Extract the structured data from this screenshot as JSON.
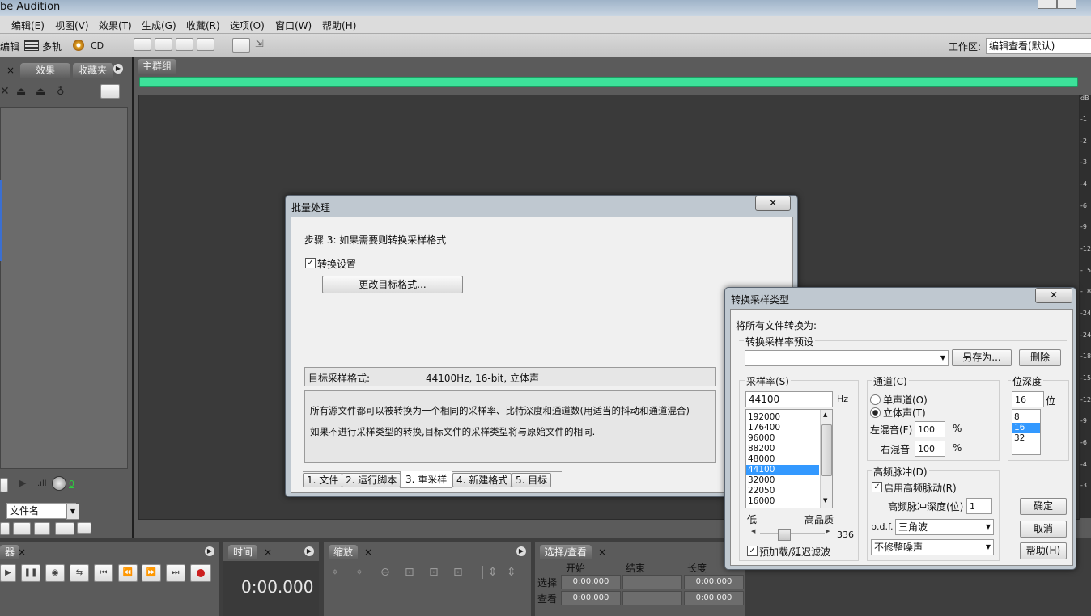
{
  "app": {
    "title": "be Audition"
  },
  "menu": [
    "编辑(E)",
    "视图(V)",
    "效果(T)",
    "生成(G)",
    "收藏(R)",
    "选项(O)",
    "窗口(W)",
    "帮助(H)"
  ],
  "toolbar": {
    "edit_label": "编辑",
    "multitrack_label": "多轨",
    "cd_label": "CD",
    "workspace_label": "工作区:",
    "workspace_value": "编辑查看(默认)"
  },
  "left_panel": {
    "tab_effects": "效果",
    "tab_favorites": "收藏夹",
    "sort_value": "文件名",
    "level_value": "0"
  },
  "main": {
    "tab_label": "主群组",
    "db_label": "dB",
    "scale_values": [
      "-1",
      "-2",
      "-3",
      "-4",
      "-6",
      "-9",
      "-12",
      "-15",
      "-18",
      "-24",
      "-24",
      "-18",
      "-15",
      "-12",
      "-9",
      "-6",
      "-4",
      "-3"
    ]
  },
  "batch_dialog": {
    "title": "批量处理",
    "step_title": "步骤 3: 如果需要则转换采样格式",
    "convert_checkbox": "转换设置",
    "change_format_button": "更改目标格式...",
    "target_format_label": "目标采样格式:",
    "target_format_value": "44100Hz, 16-bit, 立体声",
    "info_line1": "所有源文件都可以被转换为一个相同的采样率、比特深度和通道数(用适当的抖动和通道混合)",
    "info_line2": "如果不进行采样类型的转换,目标文件的采样类型将与原始文件的相同.",
    "tabs": [
      "1. 文件",
      "2. 运行脚本",
      "3. 重采样",
      "4. 新建格式",
      "5. 目标"
    ]
  },
  "convert_dialog": {
    "title": "转换采样类型",
    "convert_all_label": "将所有文件转换为:",
    "preset_label": "转换采样率预设",
    "preset_value": "",
    "save_as_button": "另存为...",
    "delete_button": "删除",
    "sample_rate_label": "采样率(S)",
    "sample_rate_value": "44100",
    "hz_label": "Hz",
    "sample_rates": [
      "192000",
      "176400",
      "96000",
      "88200",
      "48000",
      "44100",
      "32000",
      "22050",
      "16000"
    ],
    "selected_rate": "44100",
    "quality_low": "低",
    "quality_high": "高品质",
    "quality_value": "336",
    "quality_fraction": 0.33,
    "prefilter_label": "预加载/延迟滤波",
    "channels_label": "通道(C)",
    "mono_label": "单声道(O)",
    "stereo_label": "立体声(T)",
    "left_mix_label": "左混音(F)",
    "left_mix_value": "100",
    "right_mix_label": "右混音",
    "right_mix_value": "100",
    "percent": "%",
    "bit_depth_label": "位深度",
    "bit_depth_value": "16",
    "bit_unit": "位",
    "bit_depths": [
      "8",
      "16",
      "32"
    ],
    "selected_bits": "16",
    "dither_label": "高频脉冲(D)",
    "enable_dither_label": "启用高频脉动(R)",
    "dither_depth_label": "高频脉冲深度(位)",
    "dither_depth_value": "1",
    "pdf_label": "p.d.f.",
    "pdf_value": "三角波",
    "noise_shaping_value": "不修整噪声",
    "ok_button": "确定",
    "cancel_button": "取消",
    "help_button": "帮助(H)"
  },
  "bottom": {
    "transport_tab": "器",
    "time_tab": "时间",
    "time_value": "0:00.000",
    "zoom_tab": "缩放",
    "selection_tab": "选择/查看",
    "sel_headers": [
      "开始",
      "结束",
      "长度"
    ],
    "sel_row_label": "选择",
    "view_row_label": "查看",
    "sel_start": "0:00.000",
    "sel_end": "",
    "sel_length": "0:00.000",
    "view_start": "0:00.000",
    "view_end": "",
    "view_length": "0:00.000"
  },
  "colors": {
    "progress": "#3de29a",
    "selection": "#3399ff",
    "record": "#cc1f1f"
  }
}
